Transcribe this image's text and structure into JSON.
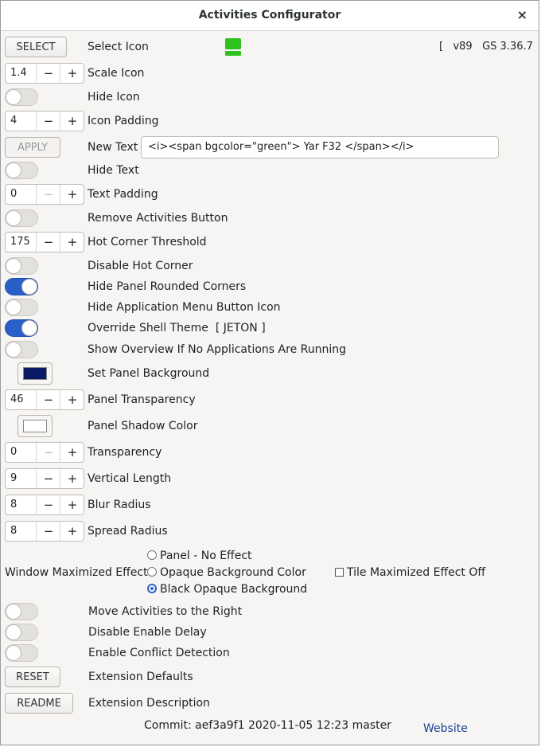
{
  "window": {
    "title": "Activities Configurator",
    "close_glyph": "×"
  },
  "rows": {
    "select": {
      "button": "SELECT",
      "label": "Select Icon",
      "icon_color": "#2fc21f",
      "version": "[   v89   GS 3.36.7   ]"
    },
    "scale_icon": {
      "value": "1.4",
      "label": "Scale Icon"
    },
    "hide_icon": {
      "label": "Hide Icon",
      "on": false
    },
    "icon_padding": {
      "value": "4",
      "label": "Icon Padding"
    },
    "new_text": {
      "button": "APPLY",
      "label": "New Text",
      "value": "<i><span bgcolor=\"green\">  Yar  F32 </span></i>"
    },
    "hide_text": {
      "label": "Hide Text",
      "on": false
    },
    "text_padding": {
      "value": "0",
      "label": "Text Padding"
    },
    "remove_activities": {
      "label": "Remove Activities Button",
      "on": false
    },
    "hot_corner_threshold": {
      "value": "175",
      "label": "Hot Corner Threshold"
    },
    "disable_hot_corner": {
      "label": "Disable Hot Corner",
      "on": false
    },
    "hide_rounded_corners": {
      "label": "Hide Panel Rounded Corners",
      "on": true
    },
    "hide_app_menu_icon": {
      "label": "Hide Application Menu Button Icon",
      "on": false
    },
    "override_theme": {
      "label": "Override Shell Theme  [ JETON ]",
      "on": true
    },
    "show_overview": {
      "label": "Show Overview If No Applications Are Running",
      "on": false
    },
    "panel_background": {
      "label": "Set Panel Background",
      "color": "#0b1a66"
    },
    "panel_transparency": {
      "value": "46",
      "label": "Panel Transparency"
    },
    "panel_shadow": {
      "label": "Panel Shadow Color",
      "color": "#ffffff"
    },
    "transparency": {
      "value": "0",
      "label": "Transparency"
    },
    "vertical_length": {
      "value": "9",
      "label": "Vertical Length"
    },
    "blur_radius": {
      "value": "8",
      "label": "Blur Radius"
    },
    "spread_radius": {
      "value": "8",
      "label": "Spread Radius"
    }
  },
  "maximized": {
    "label": "Window Maximized Effect",
    "options": [
      "Panel - No Effect",
      "Opaque Background Color",
      "Black Opaque Background"
    ],
    "selected": "Black Opaque Background",
    "tile_label": "Tile Maximized Effect Off"
  },
  "bottom": {
    "move_right": {
      "label": "Move Activities to the Right",
      "on": false
    },
    "disable_delay": {
      "label": "Disable Enable Delay",
      "on": false
    },
    "conflict": {
      "label": "Enable Conflict Detection",
      "on": false
    },
    "reset": {
      "button": "RESET",
      "label": "Extension Defaults"
    },
    "readme": {
      "button": "README",
      "label": "Extension Description"
    }
  },
  "footer": {
    "commit": "Commit: aef3a9f1 2020-11-05 12:23 master",
    "website": "Website"
  },
  "spin_symbols": {
    "minus": "−",
    "plus": "+"
  },
  "accent": "#2a5fc8"
}
